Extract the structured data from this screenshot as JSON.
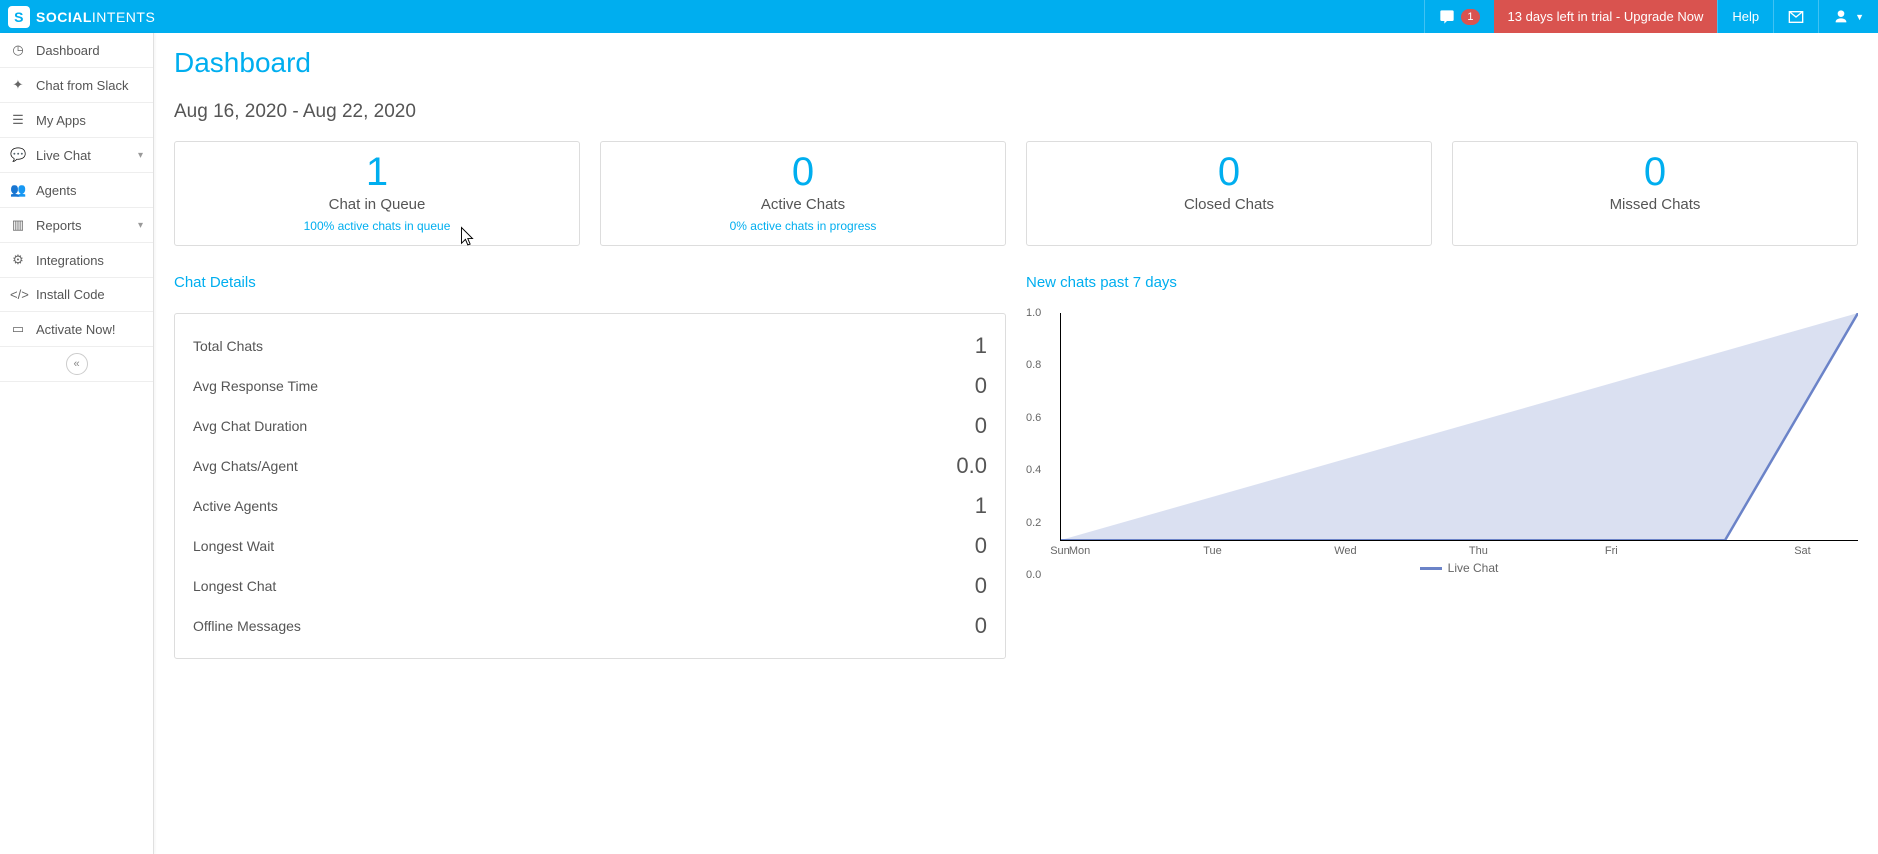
{
  "brand": {
    "name_strong": "SOCIAL",
    "name_light": "INTENTS"
  },
  "topbar": {
    "notif_count": "1",
    "upgrade_text": "13 days left in trial - Upgrade Now",
    "help_label": "Help"
  },
  "sidebar": {
    "items": [
      {
        "label": "Dashboard",
        "icon": "tachometer"
      },
      {
        "label": "Chat from Slack",
        "icon": "puzzle"
      },
      {
        "label": "My Apps",
        "icon": "comment"
      },
      {
        "label": "Live Chat",
        "icon": "comments",
        "expandable": true
      },
      {
        "label": "Agents",
        "icon": "users"
      },
      {
        "label": "Reports",
        "icon": "bar-chart",
        "expandable": true
      },
      {
        "label": "Integrations",
        "icon": "gear"
      },
      {
        "label": "Install Code",
        "icon": "code"
      },
      {
        "label": "Activate Now!",
        "icon": "card"
      }
    ]
  },
  "page": {
    "title": "Dashboard",
    "date_range": "Aug 16, 2020 - Aug 22, 2020"
  },
  "cards": [
    {
      "value": "1",
      "label": "Chat in Queue",
      "sub": "100% active chats in queue"
    },
    {
      "value": "0",
      "label": "Active Chats",
      "sub": "0% active chats in progress"
    },
    {
      "value": "0",
      "label": "Closed Chats",
      "sub": ""
    },
    {
      "value": "0",
      "label": "Missed Chats",
      "sub": ""
    }
  ],
  "sections": {
    "details_title": "Chat Details",
    "chart_title": "New chats past 7 days"
  },
  "details": [
    {
      "k": "Total Chats",
      "v": "1"
    },
    {
      "k": "Avg Response Time",
      "v": "0"
    },
    {
      "k": "Avg Chat Duration",
      "v": "0"
    },
    {
      "k": "Avg Chats/Agent",
      "v": "0.0"
    },
    {
      "k": "Active Agents",
      "v": "1"
    },
    {
      "k": "Longest Wait",
      "v": "0"
    },
    {
      "k": "Longest Chat",
      "v": "0"
    },
    {
      "k": "Offline Messages",
      "v": "0"
    }
  ],
  "chart_data": {
    "type": "area",
    "categories": [
      "Sun",
      "Mon",
      "Tue",
      "Wed",
      "Thu",
      "Fri",
      "Sat"
    ],
    "series": [
      {
        "name": "Live Chat",
        "values": [
          0,
          0,
          0,
          0,
          0,
          0,
          1
        ]
      }
    ],
    "ylim": [
      0,
      1
    ],
    "y_ticks": [
      "0.0",
      "0.2",
      "0.4",
      "0.6",
      "0.8",
      "1.0"
    ],
    "legend_label": "Live Chat"
  }
}
